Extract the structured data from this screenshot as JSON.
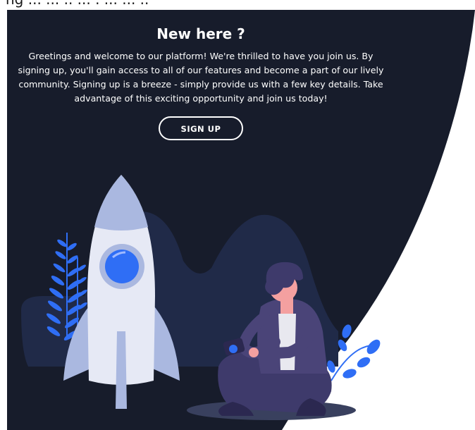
{
  "header_fragment": "ng ... ... .. ... . ... ... ..",
  "panel": {
    "title": "New here ?",
    "description": "Greetings and welcome to our platform! We're thrilled to have you join us. By signing up, you'll gain access to all of our features and become a part of our lively community. Signing up is a breeze - simply provide us with a few key details. Take advantage of this exciting opportunity and join us today!",
    "signup_label": "SIGN UP"
  },
  "colors": {
    "panel_bg": "#171c2b",
    "accent_blue": "#2f6ef5",
    "rocket_body": "#e6e9f5",
    "rocket_shade": "#aab8e0",
    "mountain": "#202a48",
    "person_purple": "#3e3a6b",
    "skin": "#f4a0a0"
  },
  "illustration": {
    "icons": [
      "rocket-illustration",
      "person-with-phone-illustration",
      "plant-leaves-illustration"
    ]
  }
}
